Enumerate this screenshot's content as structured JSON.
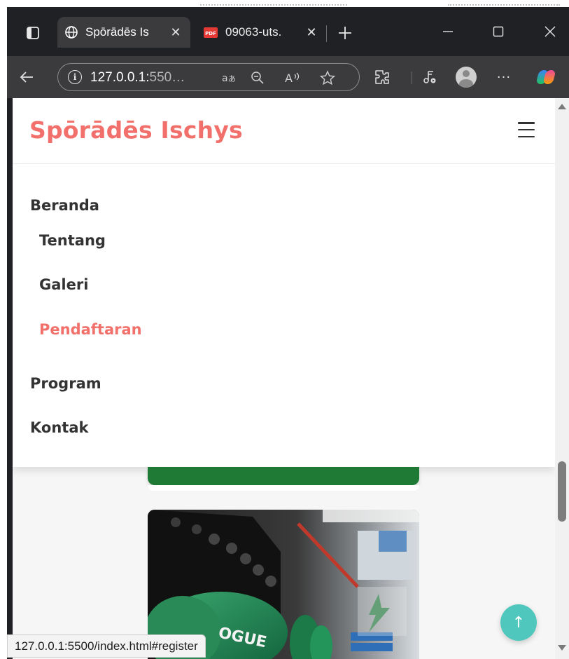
{
  "browser": {
    "tabs": [
      {
        "title": "Spōrādēs Is",
        "active": true,
        "icon": "globe-icon"
      },
      {
        "title": "09063-uts.",
        "active": false,
        "icon": "pdf-icon"
      }
    ],
    "address_bar": {
      "url_main": "127.0.0.1:",
      "url_dim": "550…",
      "icons": [
        "info-icon",
        "translate-icon",
        "zoom-out-icon",
        "read-aloud-icon",
        "favorite-star-icon"
      ]
    },
    "toolbar_icons": [
      "extensions-icon",
      "media-icon",
      "profile-icon",
      "more-icon",
      "copilot-icon"
    ],
    "window_controls": [
      "minimize-icon",
      "maximize-icon",
      "close-icon"
    ]
  },
  "site": {
    "brand": "Spōrādēs Ischys",
    "nav": {
      "items": [
        {
          "label": "Beranda",
          "active": false
        },
        {
          "label": "Tentang",
          "active": false
        },
        {
          "label": "Galeri",
          "active": false
        },
        {
          "label": "Pendaftaran",
          "active": true
        },
        {
          "label": "Program",
          "active": false
        },
        {
          "label": "Kontak",
          "active": false
        }
      ]
    },
    "back_to_top_glyph": "↑"
  },
  "status_bar": {
    "hover_url": "127.0.0.1:5500/index.html#register"
  },
  "colors": {
    "brand": "#f2706b",
    "nav_text": "#333333",
    "back_to_top": "#4fc7bd",
    "chrome_dark": "#202124",
    "chrome_toolbar": "#3b3b3d"
  }
}
